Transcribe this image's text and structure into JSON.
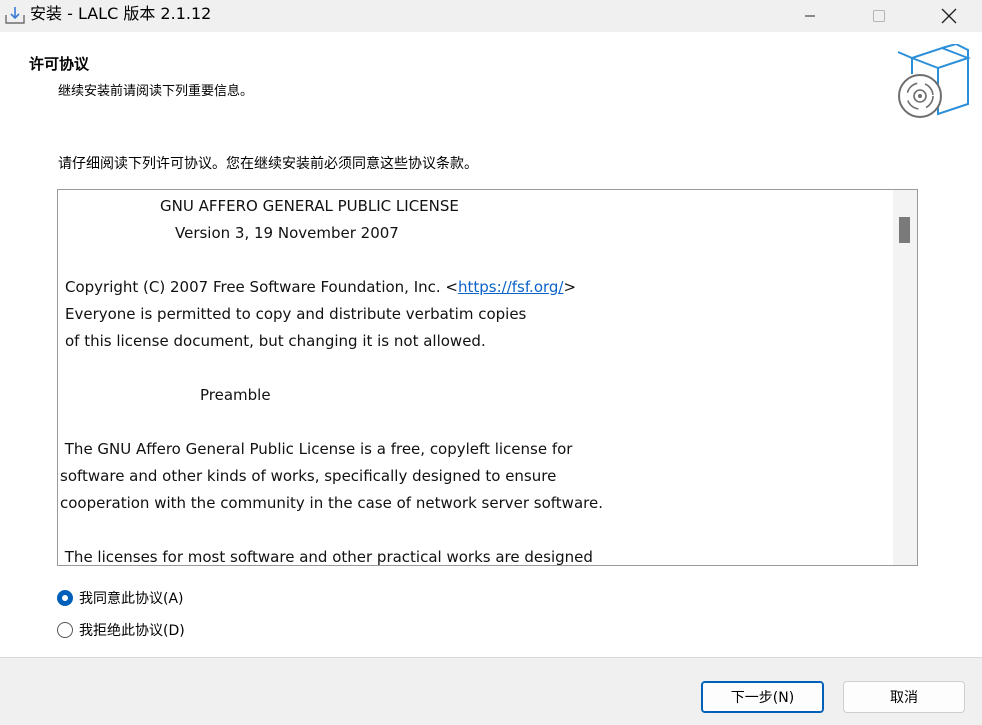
{
  "window": {
    "title": "安装 - LALC 版本 2.1.12",
    "icons": {
      "app": "installer-icon",
      "minimize": "minimize-icon",
      "maximize": "maximize-icon",
      "close": "close-icon"
    }
  },
  "header": {
    "title": "许可协议",
    "subtitle": "继续安装前请阅读下列重要信息。",
    "image": "box-with-disc-icon"
  },
  "instruction": "请仔细阅读下列许可协议。您在继续安装前必须同意这些协议条款。",
  "license": {
    "title": "GNU AFFERO GENERAL PUBLIC LICENSE",
    "version": "Version 3, 19 November 2007",
    "copyright_prefix": "Copyright (C) 2007 Free Software Foundation, Inc. <",
    "copyright_link": "https://fsf.org/",
    "copyright_suffix": ">",
    "line_permission_1": "Everyone is permitted to copy and distribute verbatim copies",
    "line_permission_2": "of this license document, but changing it is not allowed.",
    "preamble_heading": "Preamble",
    "preamble_1": " The GNU Affero General Public License is a free, copyleft license for",
    "preamble_2": "software and other kinds of works, specifically designed to ensure",
    "preamble_3": "cooperation with the community in the case of network server software.",
    "preamble_4": " The licenses for most software and other practical works are designed"
  },
  "options": {
    "accept_label": "我同意此协议(A)",
    "accept_selected": true,
    "decline_label": "我拒绝此协议(D)",
    "decline_selected": false
  },
  "buttons": {
    "next_label": "下一步(N)",
    "cancel_label": "取消"
  },
  "colors": {
    "accent": "#005fb8",
    "link": "#0b63c9",
    "chrome": "#f0f0f0"
  }
}
